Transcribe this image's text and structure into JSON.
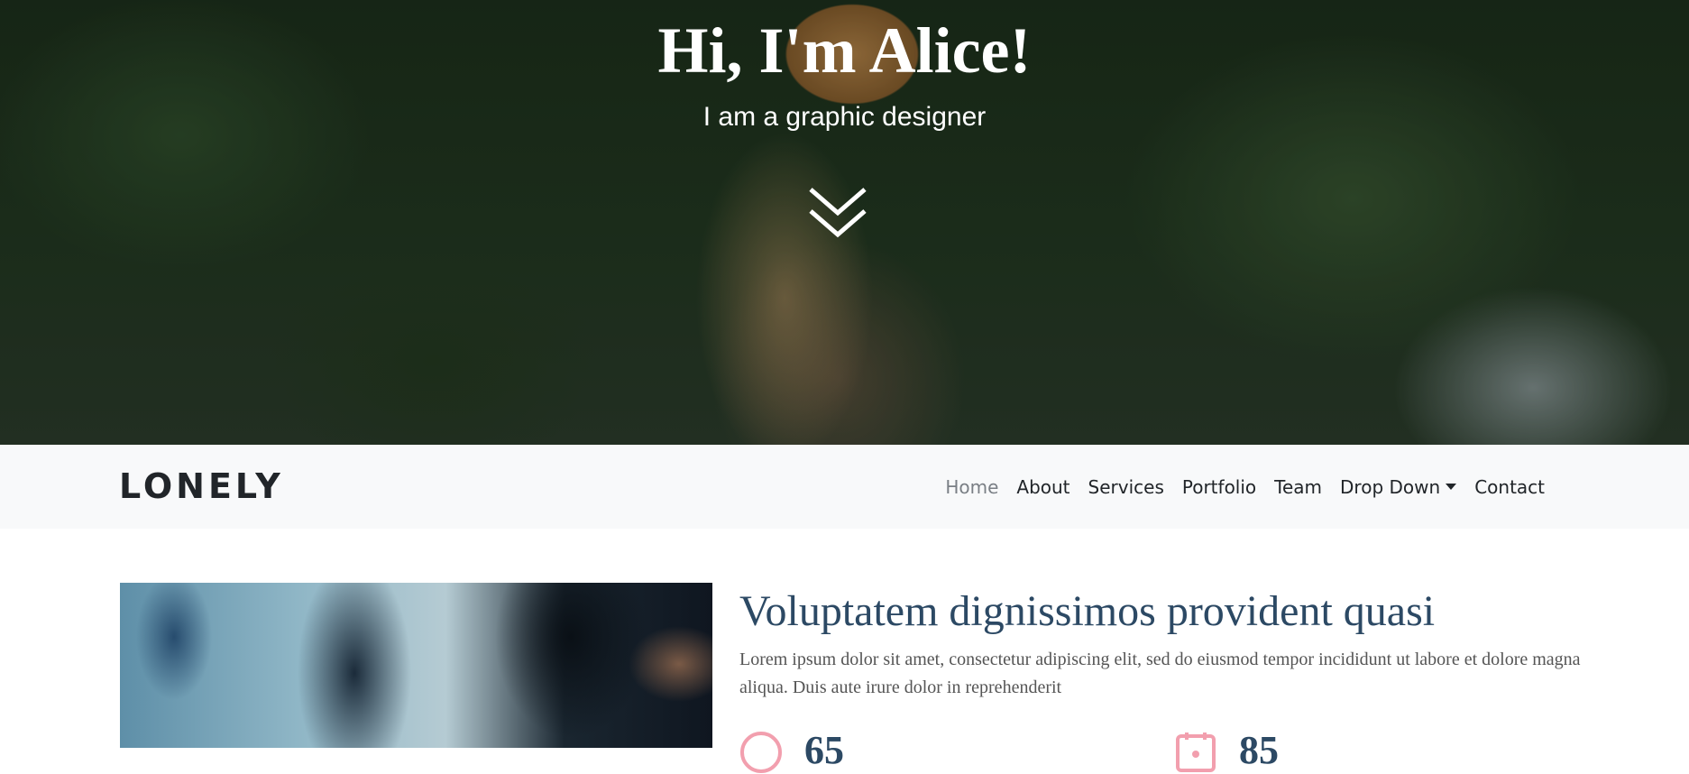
{
  "hero": {
    "title": "Hi, I'm Alice!",
    "subtitle": "I am a graphic designer",
    "scroll_icon": "double-chevron-down-icon"
  },
  "navbar": {
    "brand": "LONELY",
    "items": [
      {
        "label": "Home",
        "active": true
      },
      {
        "label": "About"
      },
      {
        "label": "Services"
      },
      {
        "label": "Portfolio"
      },
      {
        "label": "Team"
      },
      {
        "label": "Drop Down",
        "dropdown": true
      },
      {
        "label": "Contact"
      }
    ]
  },
  "about": {
    "title": "Voluptatem dignissimos provident quasi",
    "text": "Lorem ipsum dolor sit amet, consectetur adipiscing elit, sed do eiusmod tempor incididunt ut labore et dolore magna aliqua. Duis aute irure dolor in reprehenderit",
    "stats": [
      {
        "value": "65",
        "icon": "smile-icon"
      },
      {
        "value": "85",
        "icon": "calendar-icon"
      }
    ]
  },
  "colors": {
    "heading": "#2c4964",
    "navbar_bg": "#f8f9fa",
    "stat_icon": "#f29fae"
  }
}
